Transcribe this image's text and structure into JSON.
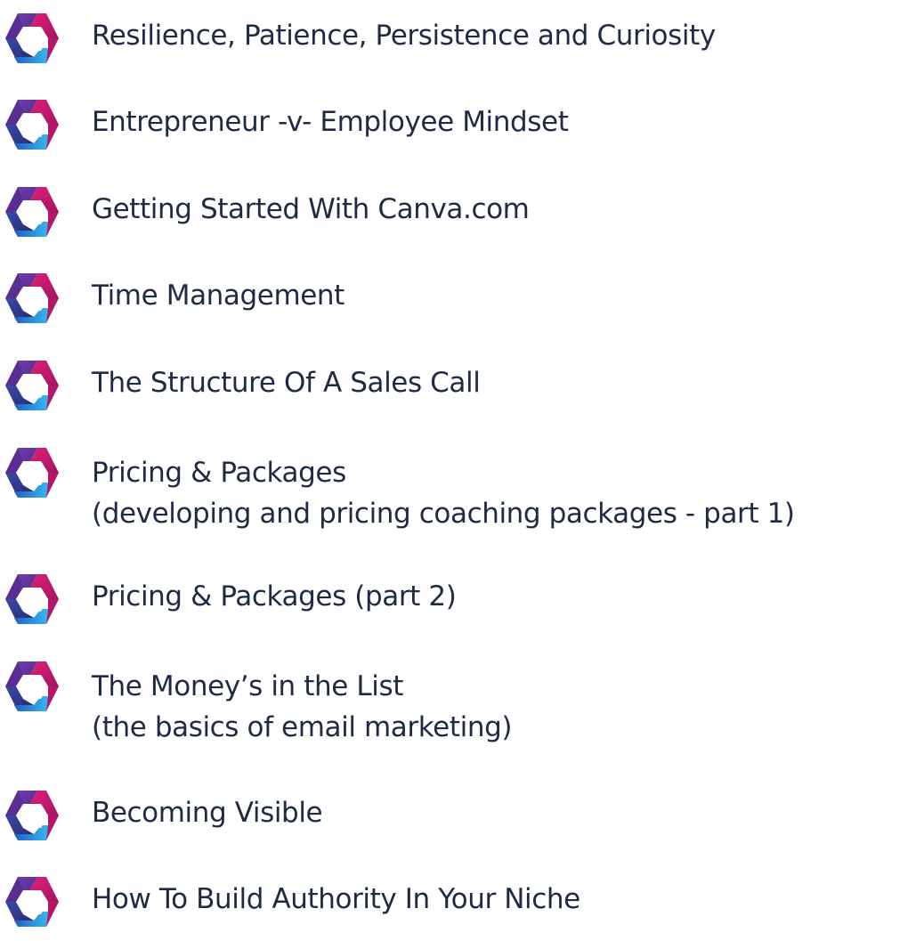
{
  "colors": {
    "text": "#1f2a44",
    "icon_purple": "#5b2a8c",
    "icon_magenta": "#c8176b",
    "icon_blue": "#2f6fd6",
    "icon_cyan": "#27b5ea",
    "icon_navy": "#2a2f7a"
  },
  "icon_name": "hexagon-swirl-icon",
  "items": [
    {
      "lines": [
        "Resilience, Patience, Persistence and Curiosity"
      ]
    },
    {
      "lines": [
        "Entrepreneur -v- Employee Mindset"
      ]
    },
    {
      "lines": [
        "Getting Started With Canva.com"
      ]
    },
    {
      "lines": [
        "Time Management"
      ]
    },
    {
      "lines": [
        "The Structure Of A Sales Call"
      ]
    },
    {
      "lines": [
        "Pricing & Packages",
        "(developing and pricing coaching packages - part 1)"
      ]
    },
    {
      "lines": [
        "Pricing & Packages (part 2)"
      ]
    },
    {
      "lines": [
        "The Money’s in the List",
        "(the basics of email marketing)"
      ]
    },
    {
      "lines": [
        "Becoming Visible"
      ]
    },
    {
      "lines": [
        "How To Build Authority In Your Niche"
      ]
    }
  ]
}
